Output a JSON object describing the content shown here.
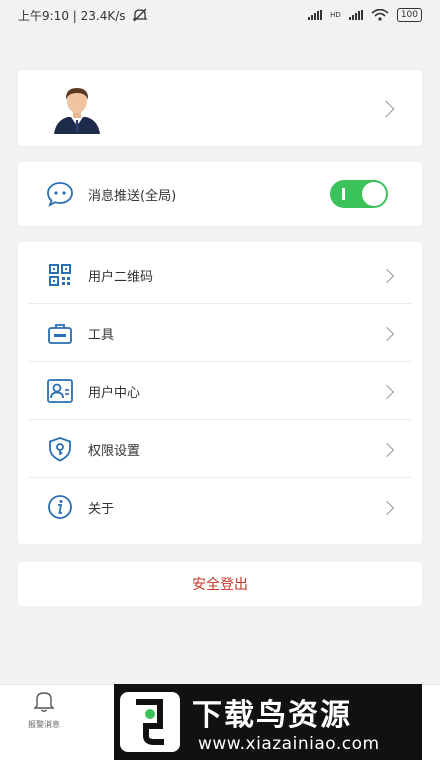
{
  "status_bar": {
    "time_speed": "上午9:10 | 23.4K/s",
    "network_badge": "HD",
    "battery": "100"
  },
  "profile": {
    "avatar_icon": "user-avatar-icon"
  },
  "push": {
    "label": "消息推送(全局)",
    "enabled": true,
    "toggle_color": "#3cc25a"
  },
  "menu": {
    "items": [
      {
        "label": "用户二维码",
        "icon": "qr-code-icon"
      },
      {
        "label": "工具",
        "icon": "toolbox-icon"
      },
      {
        "label": "用户中心",
        "icon": "user-card-icon"
      },
      {
        "label": "权限设置",
        "icon": "shield-key-icon"
      },
      {
        "label": "关于",
        "icon": "info-icon"
      }
    ]
  },
  "logout": {
    "label": "安全登出",
    "color": "#c0392b"
  },
  "bottom_nav": {
    "alert_label": "报警消息"
  },
  "watermark": {
    "title": "下载鸟资源",
    "url": "www.xiazainiao.com"
  },
  "colors": {
    "accent_blue": "#2a6fb3",
    "background": "#f2f2f2"
  }
}
